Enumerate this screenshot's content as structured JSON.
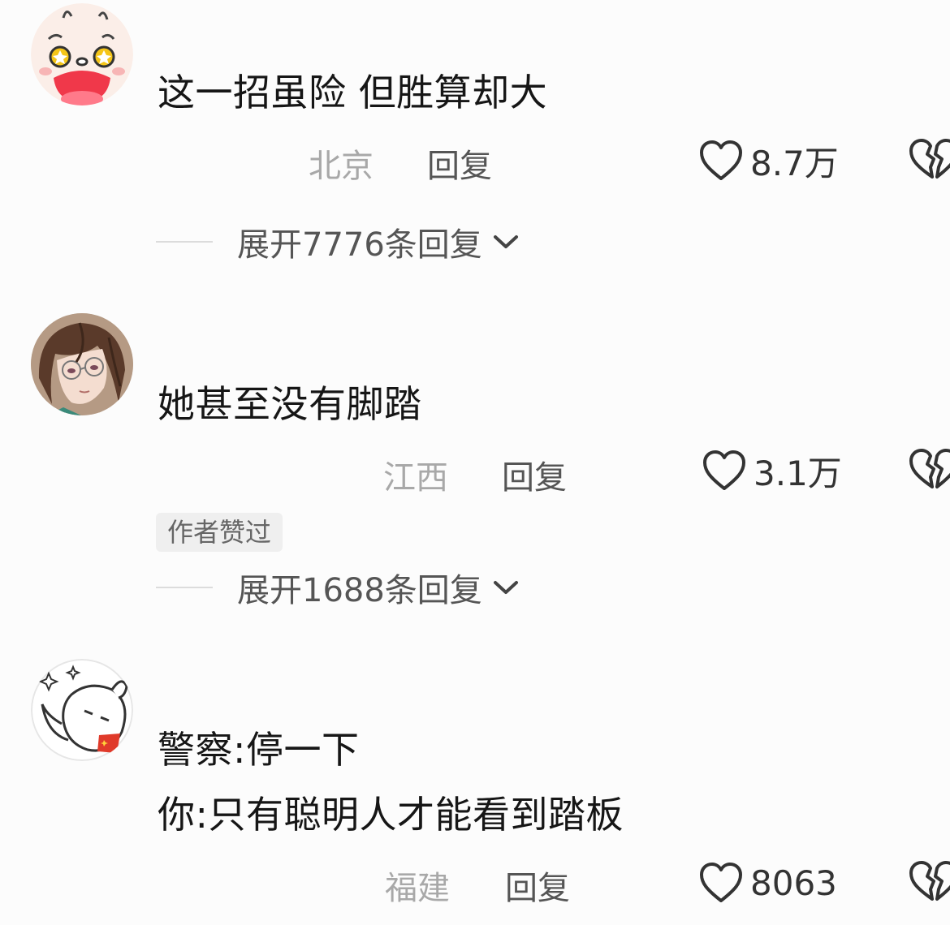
{
  "comments": [
    {
      "avatar": "bunny-cartoon-avatar",
      "text": "这一招虽险 但胜算却大",
      "location": "北京",
      "reply_label": "回复",
      "likes": "8.7万",
      "expand_label": "展开7776条回复"
    },
    {
      "avatar": "anime-character-avatar",
      "text": "她甚至没有脚踏",
      "location": "江西",
      "reply_label": "回复",
      "likes": "3.1万",
      "badge": "作者赞过",
      "expand_label": "展开1688条回复"
    },
    {
      "avatar": "line-drawing-rabbit-avatar",
      "text_lines": [
        "警察:停一下",
        "你:只有聪明人才能看到踏板"
      ],
      "location": "福建",
      "reply_label": "回复",
      "likes": "8063"
    }
  ],
  "icons": {
    "like": "heart-outline-icon",
    "dislike": "broken-heart-icon",
    "expand": "chevron-down-icon"
  },
  "colors": {
    "background": "#fcfcfc",
    "text": "#161616",
    "secondary": "#a8a8a8",
    "badge_bg": "#efefef"
  }
}
